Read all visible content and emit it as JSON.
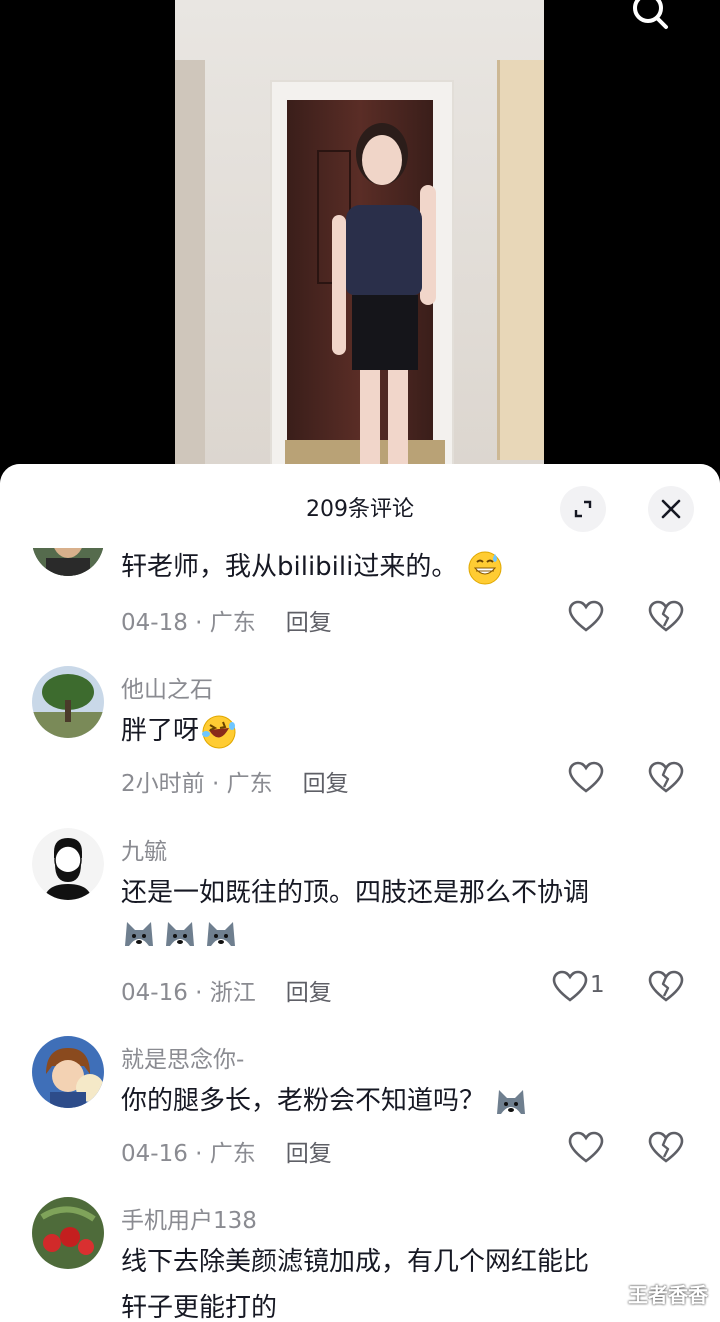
{
  "sheet": {
    "count_label": "209条评论"
  },
  "comments": [
    {
      "username": "",
      "text": "轩老师，我从bilibili过来的。",
      "date": "04-18",
      "location": "广东",
      "reply_label": "回复",
      "like_count": ""
    },
    {
      "username": "他山之石",
      "text": "胖了呀",
      "date": "2小时前",
      "location": "广东",
      "reply_label": "回复",
      "like_count": ""
    },
    {
      "username": "九毓",
      "text": "还是一如既往的顶。四肢还是那么不协调",
      "date": "04-16",
      "location": "浙江",
      "reply_label": "回复",
      "like_count": "1"
    },
    {
      "username": "就是思念你-",
      "text": "你的腿多长，老粉会不知道吗？",
      "date": "04-16",
      "location": "广东",
      "reply_label": "回复",
      "like_count": ""
    },
    {
      "username": "手机用户138",
      "text_line1": "线下去除美颜滤镜加成，有几个网红能比",
      "text_line2": "轩子更能打的"
    }
  ],
  "watermark": "王者香香",
  "icons": {
    "search": "search-icon",
    "expand": "expand-icon",
    "close": "close-icon",
    "like": "heart-icon",
    "dislike": "broken-heart-icon"
  }
}
